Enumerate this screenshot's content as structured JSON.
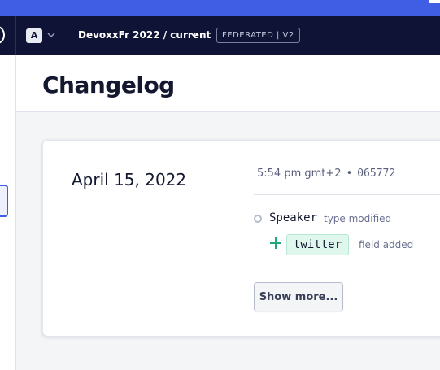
{
  "nav": {
    "account_initial": "A",
    "graph": "DevoxxFr 2022 / current",
    "badge": "FEDERATED | V2"
  },
  "page": {
    "title": "Changelog"
  },
  "entry": {
    "date": "April 15, 2022",
    "time": "5:54 pm gmt+2",
    "separator": "•",
    "hash": "065772",
    "changes": [
      {
        "name": "Speaker",
        "description": "type modified"
      },
      {
        "name": "twitter",
        "description": "field added"
      }
    ],
    "show_more_label": "Show more..."
  },
  "colors": {
    "accent": "#3f5ee4",
    "navbar": "#0f1436",
    "added": "#1fa97b"
  }
}
